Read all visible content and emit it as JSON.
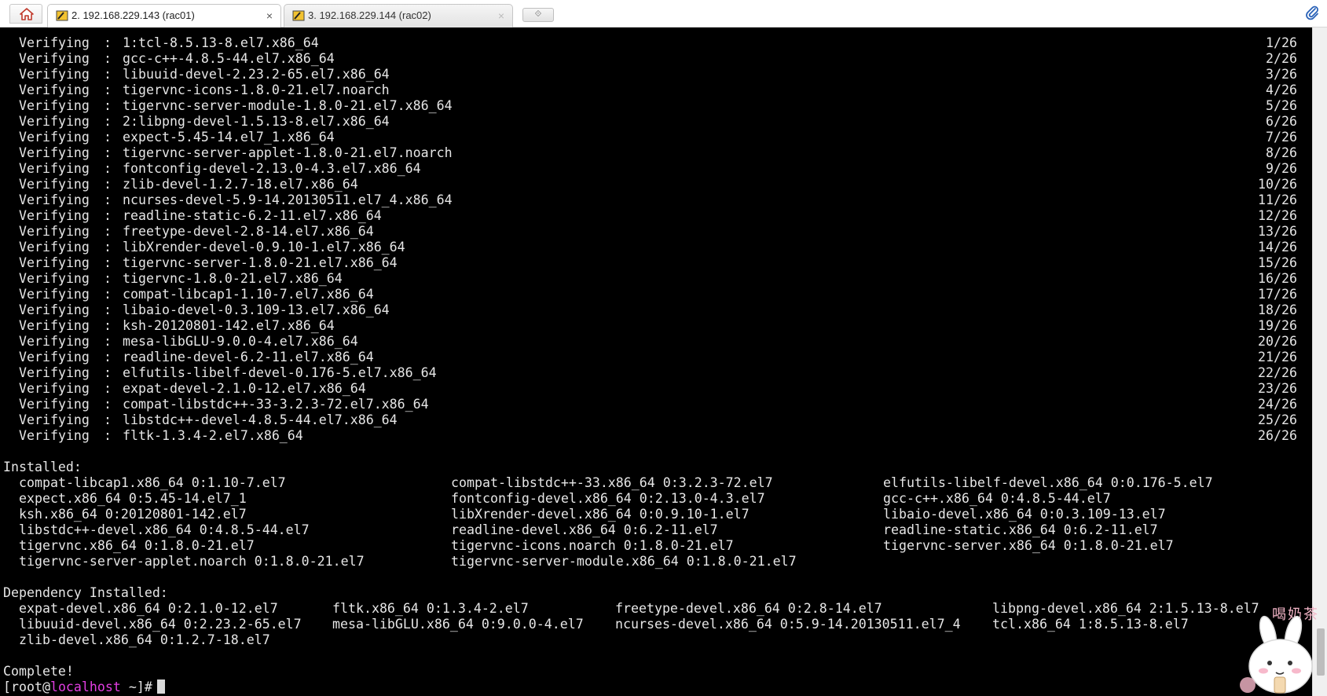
{
  "tabs": {
    "home_icon": "home-icon",
    "items": [
      {
        "label": "2. 192.168.229.143 (rac01)",
        "icon": "putty-terminal-icon",
        "close": "×",
        "active": true
      },
      {
        "label": "3. 192.168.229.144 (rac02)",
        "icon": "putty-terminal-icon",
        "close": "×",
        "active": false
      }
    ],
    "new_tab_symbol": "⟐",
    "attach_icon": "paperclip-icon"
  },
  "terminal": {
    "verify_lines": [
      {
        "action": "Verifying",
        "package": "1:tcl-8.5.13-8.el7.x86_64",
        "count": "1/26"
      },
      {
        "action": "Verifying",
        "package": "gcc-c++-4.8.5-44.el7.x86_64",
        "count": "2/26"
      },
      {
        "action": "Verifying",
        "package": "libuuid-devel-2.23.2-65.el7.x86_64",
        "count": "3/26"
      },
      {
        "action": "Verifying",
        "package": "tigervnc-icons-1.8.0-21.el7.noarch",
        "count": "4/26"
      },
      {
        "action": "Verifying",
        "package": "tigervnc-server-module-1.8.0-21.el7.x86_64",
        "count": "5/26"
      },
      {
        "action": "Verifying",
        "package": "2:libpng-devel-1.5.13-8.el7.x86_64",
        "count": "6/26"
      },
      {
        "action": "Verifying",
        "package": "expect-5.45-14.el7_1.x86_64",
        "count": "7/26"
      },
      {
        "action": "Verifying",
        "package": "tigervnc-server-applet-1.8.0-21.el7.noarch",
        "count": "8/26"
      },
      {
        "action": "Verifying",
        "package": "fontconfig-devel-2.13.0-4.3.el7.x86_64",
        "count": "9/26"
      },
      {
        "action": "Verifying",
        "package": "zlib-devel-1.2.7-18.el7.x86_64",
        "count": "10/26"
      },
      {
        "action": "Verifying",
        "package": "ncurses-devel-5.9-14.20130511.el7_4.x86_64",
        "count": "11/26"
      },
      {
        "action": "Verifying",
        "package": "readline-static-6.2-11.el7.x86_64",
        "count": "12/26"
      },
      {
        "action": "Verifying",
        "package": "freetype-devel-2.8-14.el7.x86_64",
        "count": "13/26"
      },
      {
        "action": "Verifying",
        "package": "libXrender-devel-0.9.10-1.el7.x86_64",
        "count": "14/26"
      },
      {
        "action": "Verifying",
        "package": "tigervnc-server-1.8.0-21.el7.x86_64",
        "count": "15/26"
      },
      {
        "action": "Verifying",
        "package": "tigervnc-1.8.0-21.el7.x86_64",
        "count": "16/26"
      },
      {
        "action": "Verifying",
        "package": "compat-libcap1-1.10-7.el7.x86_64",
        "count": "17/26"
      },
      {
        "action": "Verifying",
        "package": "libaio-devel-0.3.109-13.el7.x86_64",
        "count": "18/26"
      },
      {
        "action": "Verifying",
        "package": "ksh-20120801-142.el7.x86_64",
        "count": "19/26"
      },
      {
        "action": "Verifying",
        "package": "mesa-libGLU-9.0.0-4.el7.x86_64",
        "count": "20/26"
      },
      {
        "action": "Verifying",
        "package": "readline-devel-6.2-11.el7.x86_64",
        "count": "21/26"
      },
      {
        "action": "Verifying",
        "package": "elfutils-libelf-devel-0.176-5.el7.x86_64",
        "count": "22/26"
      },
      {
        "action": "Verifying",
        "package": "expat-devel-2.1.0-12.el7.x86_64",
        "count": "23/26"
      },
      {
        "action": "Verifying",
        "package": "compat-libstdc++-33-3.2.3-72.el7.x86_64",
        "count": "24/26"
      },
      {
        "action": "Verifying",
        "package": "libstdc++-devel-4.8.5-44.el7.x86_64",
        "count": "25/26"
      },
      {
        "action": "Verifying",
        "package": "fltk-1.3.4-2.el7.x86_64",
        "count": "26/26"
      }
    ],
    "installed_header": "Installed:",
    "installed_rows": [
      [
        "compat-libcap1.x86_64 0:1.10-7.el7",
        "compat-libstdc++-33.x86_64 0:3.2.3-72.el7",
        "elfutils-libelf-devel.x86_64 0:0.176-5.el7"
      ],
      [
        "expect.x86_64 0:5.45-14.el7_1",
        "fontconfig-devel.x86_64 0:2.13.0-4.3.el7",
        "gcc-c++.x86_64 0:4.8.5-44.el7"
      ],
      [
        "ksh.x86_64 0:20120801-142.el7",
        "libXrender-devel.x86_64 0:0.9.10-1.el7",
        "libaio-devel.x86_64 0:0.3.109-13.el7"
      ],
      [
        "libstdc++-devel.x86_64 0:4.8.5-44.el7",
        "readline-devel.x86_64 0:6.2-11.el7",
        "readline-static.x86_64 0:6.2-11.el7"
      ],
      [
        "tigervnc.x86_64 0:1.8.0-21.el7",
        "tigervnc-icons.noarch 0:1.8.0-21.el7",
        "tigervnc-server.x86_64 0:1.8.0-21.el7"
      ],
      [
        "tigervnc-server-applet.noarch 0:1.8.0-21.el7",
        "tigervnc-server-module.x86_64 0:1.8.0-21.el7",
        ""
      ]
    ],
    "dependency_header": "Dependency Installed:",
    "dependency_rows": [
      [
        "expat-devel.x86_64 0:2.1.0-12.el7",
        "fltk.x86_64 0:1.3.4-2.el7",
        "freetype-devel.x86_64 0:2.8-14.el7",
        "libpng-devel.x86_64 2:1.5.13-8.el7"
      ],
      [
        "libuuid-devel.x86_64 0:2.23.2-65.el7",
        "mesa-libGLU.x86_64 0:9.0.0-4.el7",
        "ncurses-devel.x86_64 0:5.9-14.20130511.el7_4",
        "tcl.x86_64 1:8.5.13-8.el7"
      ],
      [
        "zlib-devel.x86_64 0:1.2.7-18.el7",
        "",
        "",
        ""
      ]
    ],
    "complete_text": "Complete!",
    "prompt": {
      "open": "[root@",
      "host": "localhost",
      "rest": " ~]#"
    },
    "host_color": "#e23ee2"
  },
  "watermark": {
    "text": "喝奶茶",
    "icon": "bunny-sticker-icon"
  }
}
